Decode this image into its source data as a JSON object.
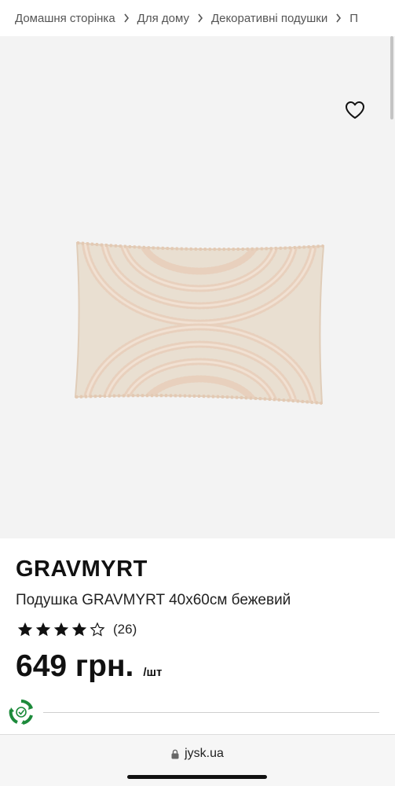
{
  "breadcrumb": {
    "items": [
      "Домашня сторінка",
      "Для дому",
      "Декоративні подушки",
      "П"
    ]
  },
  "gallery": {
    "image_icon": "pillow-product-image",
    "wishlist_icon": "heart-outline-icon",
    "dots_total": 4,
    "active_dot": 0
  },
  "product": {
    "brand": "GRAVMYRT",
    "name": "Подушка GRAVMYRT 40x60см бежевий",
    "rating": 4,
    "rating_max": 5,
    "rating_count": "(26)",
    "price": "649 грн.",
    "unit": "/шт"
  },
  "eco_badge": {
    "icon": "eco-recycle-badge-icon"
  },
  "browser": {
    "url": "jysk.ua",
    "lock_icon": "lock-icon"
  },
  "colors": {
    "gallery_bg": "#f3f3f3",
    "pillow_base": "#e9dfd1",
    "pillow_tuft": "#e8d0bd",
    "star": "#111111",
    "eco_green": "#1c8a3a"
  }
}
